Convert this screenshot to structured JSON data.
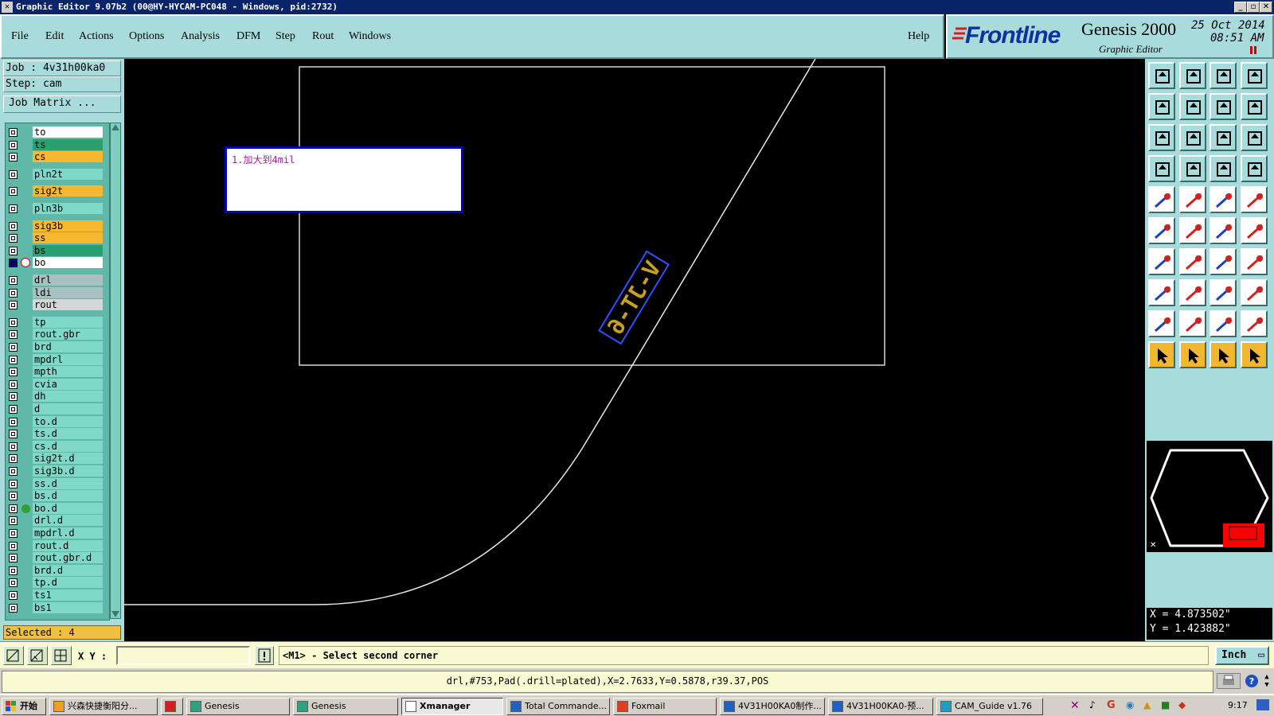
{
  "window": {
    "title": "Graphic Editor 9.07b2  (00@HY-HYCAM-PC048 - Windows, pid:2732)"
  },
  "menu": {
    "items": [
      "File",
      "Edit",
      "Actions",
      "Options",
      "Analysis",
      "DFM",
      "Step",
      "Rout",
      "Windows"
    ],
    "help": "Help"
  },
  "brand": {
    "logo": "Frontline",
    "product": "Genesis 2000",
    "subtitle": "Graphic Editor",
    "date": "25 Oct 2014",
    "time": "08:51 AM"
  },
  "job": {
    "job_label": "Job  : 4v31h00ka0",
    "step_label": "Step: cam",
    "matrix_button": "Job Matrix ..."
  },
  "layers": [
    {
      "name": "to",
      "color": "#ffffff"
    },
    {
      "name": "ts",
      "color": "#2aa070"
    },
    {
      "name": "cs",
      "color": "#f5b830"
    },
    {
      "name": "pln2t",
      "color": "#7fd8c8"
    },
    {
      "name": "sig2t",
      "color": "#f5b830"
    },
    {
      "name": "pln3b",
      "color": "#7fd8c8"
    },
    {
      "name": "sig3b",
      "color": "#f5b830"
    },
    {
      "name": "ss",
      "color": "#f5b830"
    },
    {
      "name": "bs",
      "color": "#2aa070"
    },
    {
      "name": "bo",
      "color": "#ffffff"
    },
    {
      "name": "drl",
      "color": "#a8c0c0"
    },
    {
      "name": "ldi",
      "color": "#a8c0c0"
    },
    {
      "name": "rout",
      "color": "#d0d8d8"
    },
    {
      "name": "tp",
      "color": "#7fd8c8"
    },
    {
      "name": "rout.gbr",
      "color": "#7fd8c8"
    },
    {
      "name": "brd",
      "color": "#7fd8c8"
    },
    {
      "name": "mpdrl",
      "color": "#7fd8c8"
    },
    {
      "name": "mpth",
      "color": "#7fd8c8"
    },
    {
      "name": "cvia",
      "color": "#7fd8c8"
    },
    {
      "name": "dh",
      "color": "#7fd8c8"
    },
    {
      "name": "d",
      "color": "#7fd8c8"
    },
    {
      "name": "to.d",
      "color": "#7fd8c8"
    },
    {
      "name": "ts.d",
      "color": "#7fd8c8"
    },
    {
      "name": "cs.d",
      "color": "#7fd8c8"
    },
    {
      "name": "sig2t.d",
      "color": "#7fd8c8"
    },
    {
      "name": "sig3b.d",
      "color": "#7fd8c8"
    },
    {
      "name": "ss.d",
      "color": "#7fd8c8"
    },
    {
      "name": "bs.d",
      "color": "#7fd8c8"
    },
    {
      "name": "bo.d",
      "color": "#7fd8c8"
    },
    {
      "name": "drl.d",
      "color": "#7fd8c8"
    },
    {
      "name": "mpdrl.d",
      "color": "#7fd8c8"
    },
    {
      "name": "rout.d",
      "color": "#7fd8c8"
    },
    {
      "name": "rout.gbr.d",
      "color": "#7fd8c8"
    },
    {
      "name": "brd.d",
      "color": "#7fd8c8"
    },
    {
      "name": "tp.d",
      "color": "#7fd8c8"
    },
    {
      "name": "ts1",
      "color": "#7fd8c8"
    },
    {
      "name": "bs1",
      "color": "#7fd8c8"
    }
  ],
  "selected_label": "Selected : 4",
  "canvas": {
    "note_text": "1.加大到4mil",
    "feature_text": "V-JT-6"
  },
  "coords": {
    "x": "X =  4.873502\"",
    "y": "Y =  1.423882\""
  },
  "command": {
    "xy_label": "X Y :",
    "xy_value": "",
    "prompt": "<M1> - Select second corner",
    "unit": "Inch"
  },
  "status": {
    "text": "drl,#753,Pad(.drill=plated),X=2.7633,Y=0.5878,r39.37,POS"
  },
  "taskbar": {
    "start": "开始",
    "tasks": [
      {
        "label": "兴森快捷衡阳分...",
        "w": 136
      },
      {
        "label": "",
        "w": 28
      },
      {
        "label": "Genesis",
        "w": 130
      },
      {
        "label": "Genesis",
        "w": 132
      },
      {
        "label": "Xmanager",
        "w": 128
      },
      {
        "label": "Total Commande...",
        "w": 130
      },
      {
        "label": "Foxmail",
        "w": 130
      },
      {
        "label": "4V31H00KA0制作...",
        "w": 132
      },
      {
        "label": "4V31H00KA0-预...",
        "w": 132
      },
      {
        "label": "CAM_Guide v1.76",
        "w": 134
      }
    ],
    "clock": "9:17"
  }
}
